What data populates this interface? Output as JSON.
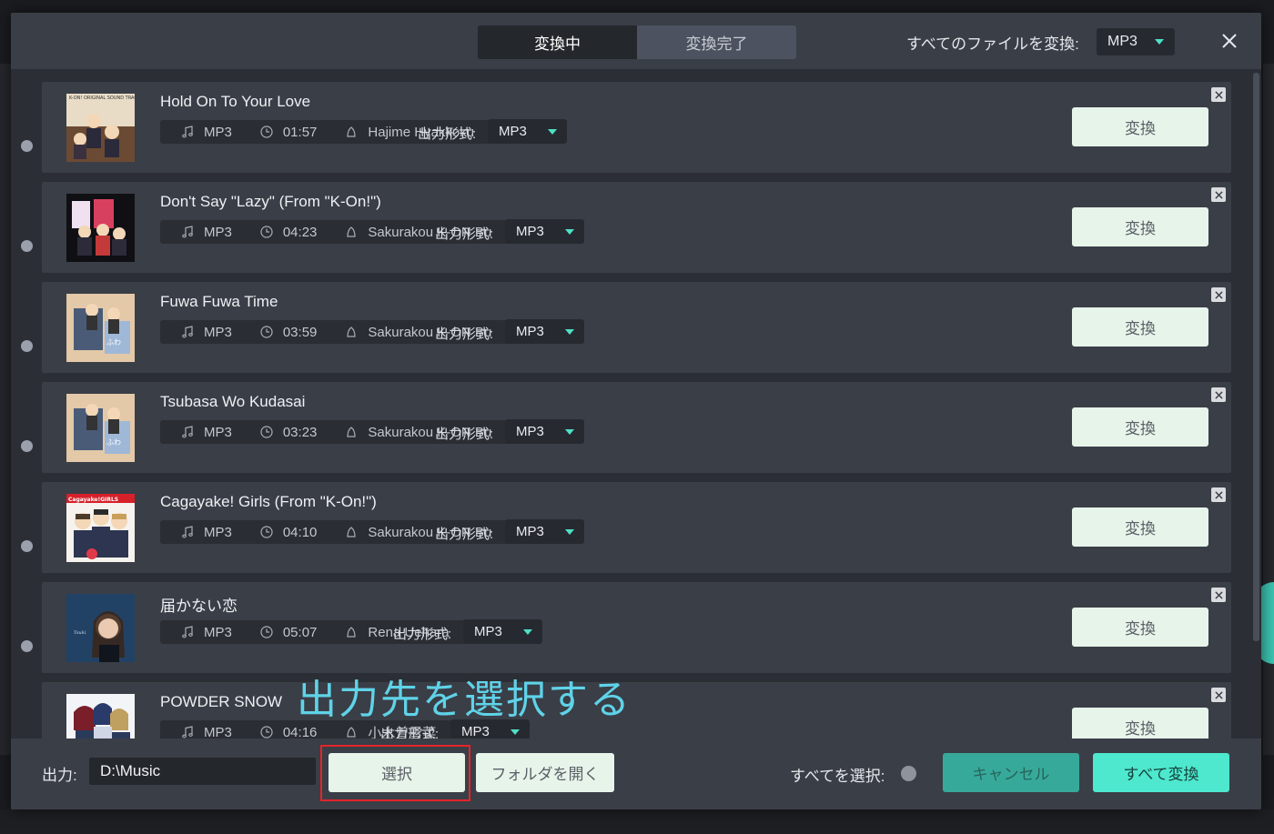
{
  "header": {
    "tabs": [
      {
        "label": "変換中",
        "active": true
      },
      {
        "label": "変換完了",
        "active": false
      }
    ],
    "convert_all_label": "すべてのファイルを変換:",
    "convert_all_format": "MP3"
  },
  "tracks": [
    {
      "title": "Hold On To Your Love",
      "format": "MP3",
      "duration": "01:57",
      "artist": "Hajime Hyakkoku",
      "output_label": "出力形式:",
      "output_format": "MP3",
      "convert_label": "変換",
      "cover": "kon-ost"
    },
    {
      "title": "Don't Say \"Lazy\" (From \"K-On!\")",
      "format": "MP3",
      "duration": "04:23",
      "artist": "Sakurakou K-ON Bu",
      "output_label": "出力形式:",
      "output_format": "MP3",
      "convert_label": "変換",
      "cover": "lazy"
    },
    {
      "title": "Fuwa Fuwa Time",
      "format": "MP3",
      "duration": "03:59",
      "artist": "Sakurakou K-ON Bu",
      "output_label": "出力形式:",
      "output_format": "MP3",
      "convert_label": "変換",
      "cover": "fuwa"
    },
    {
      "title": "Tsubasa Wo Kudasai",
      "format": "MP3",
      "duration": "03:23",
      "artist": "Sakurakou K-ON Bu",
      "output_label": "出力形式:",
      "output_format": "MP3",
      "convert_label": "変換",
      "cover": "fuwa"
    },
    {
      "title": "Cagayake! Girls (From \"K-On!\")",
      "format": "MP3",
      "duration": "04:10",
      "artist": "Sakurakou K-ON Bu",
      "output_label": "出力形式:",
      "output_format": "MP3",
      "convert_label": "変換",
      "cover": "cagayake"
    },
    {
      "title": "届かない恋",
      "format": "MP3",
      "duration": "05:07",
      "artist": "Rena Uehara",
      "output_label": "出力形式:",
      "output_format": "MP3",
      "convert_label": "変換",
      "cover": "rena"
    },
    {
      "title": "POWDER SNOW",
      "format": "MP3",
      "duration": "04:16",
      "artist": "小木曽雪菜",
      "output_label": "出力形式:",
      "output_format": "MP3",
      "convert_label": "変換",
      "cover": "powder"
    }
  ],
  "cover_logos": {
    "kon_ost": "K-ON! ORIGINAL SOUND TRACK",
    "cagayake": "Cagayake!GIRLS"
  },
  "annotation": "出力先を選択する",
  "footer": {
    "output_label": "出力:",
    "output_path": "D:\\Music",
    "select_button": "選択",
    "open_folder_button": "フォルダを開く",
    "select_all_label": "すべてを選択:",
    "cancel_button": "キャンセル",
    "convert_all_button": "すべて変換"
  },
  "colors": {
    "accent": "#4de8ce",
    "cancel": "#37a99a",
    "light_button": "#e7f4ea",
    "highlight": "#e5242a",
    "annotation": "#5fd3e8"
  }
}
